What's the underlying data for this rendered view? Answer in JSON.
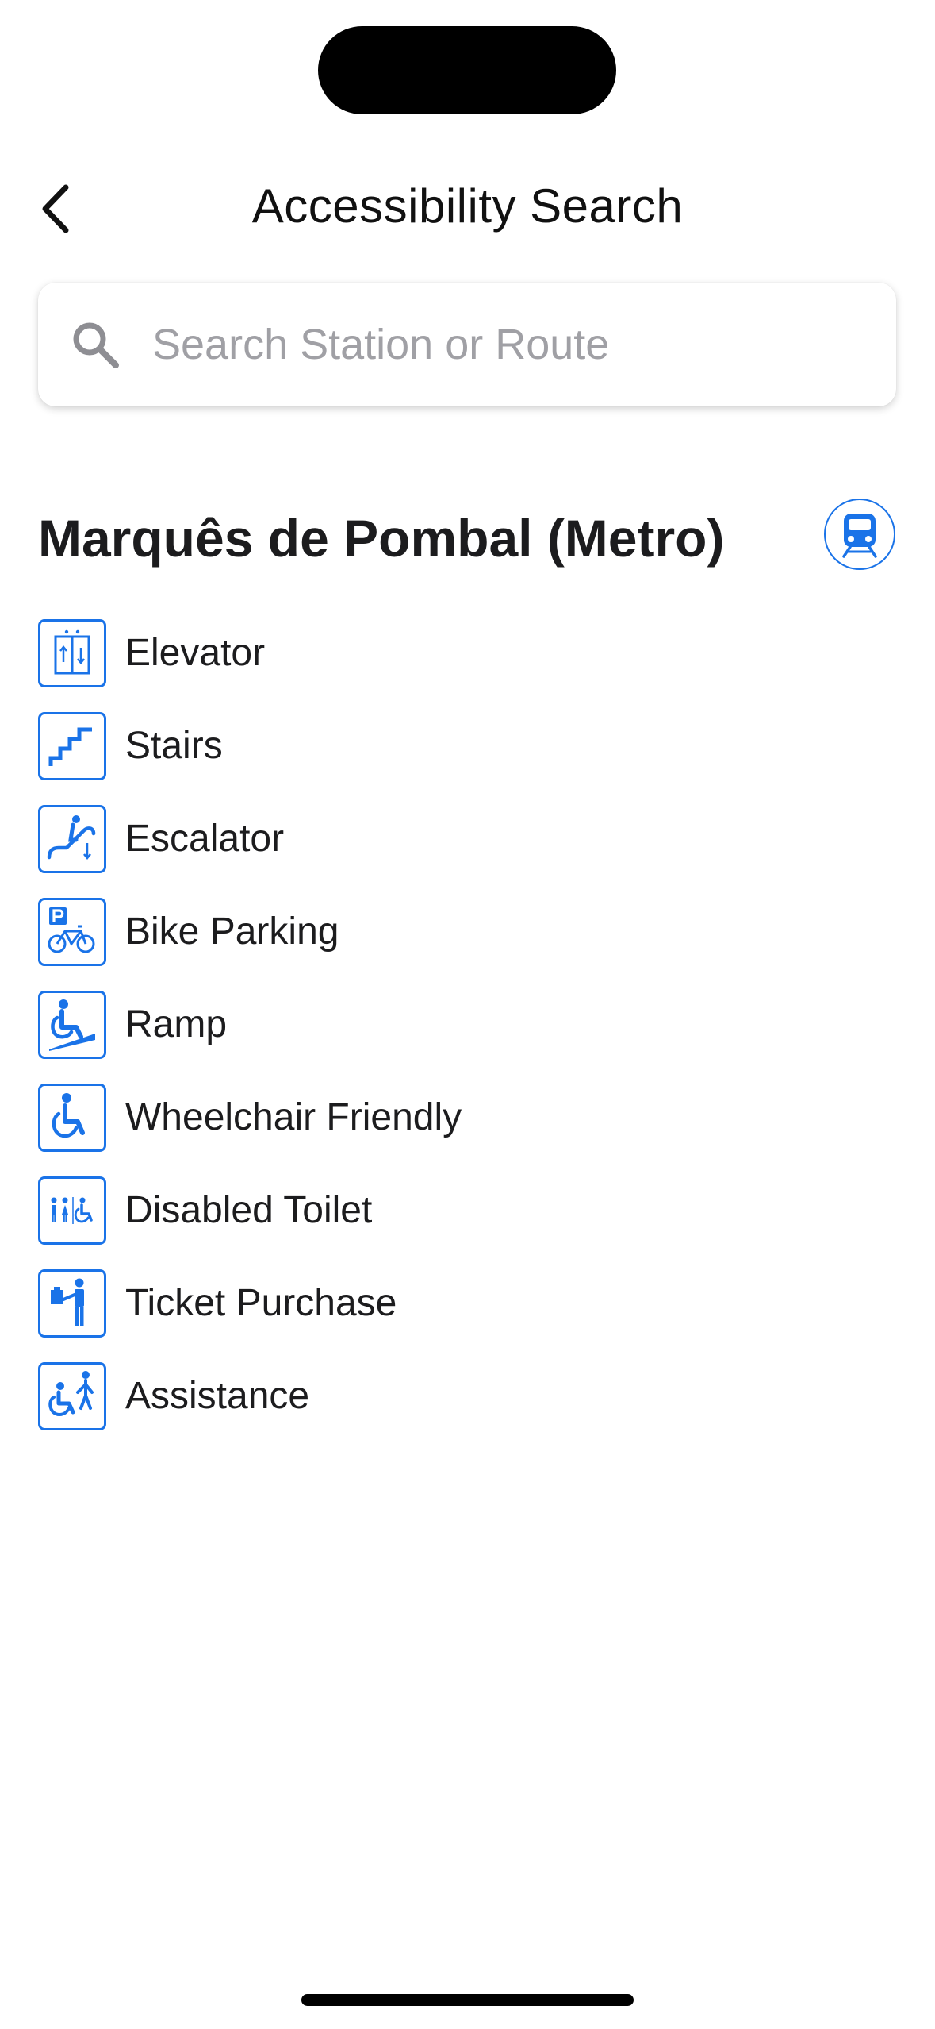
{
  "header": {
    "title": "Accessibility Search",
    "back_icon": "chevron-left-icon"
  },
  "search": {
    "placeholder": "Search Station or Route",
    "value": "",
    "icon": "search-icon"
  },
  "station": {
    "name": "Marquês de Pombal (Metro)",
    "transport_icon": "metro-train-icon"
  },
  "features": [
    {
      "label": "Elevator",
      "icon": "elevator-icon"
    },
    {
      "label": "Stairs",
      "icon": "stairs-icon"
    },
    {
      "label": "Escalator",
      "icon": "escalator-icon"
    },
    {
      "label": "Bike Parking",
      "icon": "bike-parking-icon"
    },
    {
      "label": "Ramp",
      "icon": "ramp-icon"
    },
    {
      "label": "Wheelchair Friendly",
      "icon": "wheelchair-icon"
    },
    {
      "label": "Disabled Toilet",
      "icon": "disabled-toilet-icon"
    },
    {
      "label": "Ticket Purchase",
      "icon": "ticket-purchase-icon"
    },
    {
      "label": "Assistance",
      "icon": "assistance-icon"
    }
  ],
  "colors": {
    "accent": "#1a73e8",
    "text": "#1c1c1e",
    "placeholder": "#a0a0a5",
    "background": "#ffffff"
  }
}
